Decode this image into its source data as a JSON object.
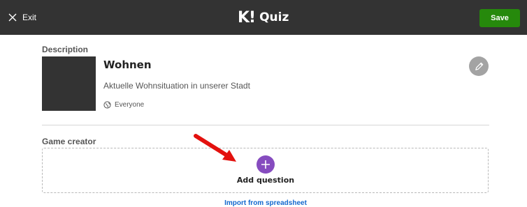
{
  "topbar": {
    "exit_label": "Exit",
    "logo_mark": "K!",
    "logo_text": "Quiz",
    "save_label": "Save",
    "background": "#333333",
    "save_color": "#26890c"
  },
  "description": {
    "section_label": "Description",
    "quiz_title": "Wohnen",
    "quiz_description": "Aktuelle Wohnsituation in unserer Stadt",
    "visibility": "Everyone",
    "edit_icon": "pencil-icon"
  },
  "game_creator": {
    "section_label": "Game creator",
    "add_question_label": "Add question",
    "add_icon": "plus-icon",
    "accent_color": "#864cbf"
  },
  "import_link": "Import from spreadsheet",
  "annotation": {
    "arrow_color": "#e3110e",
    "arrow_icon": "red-arrow-icon"
  }
}
